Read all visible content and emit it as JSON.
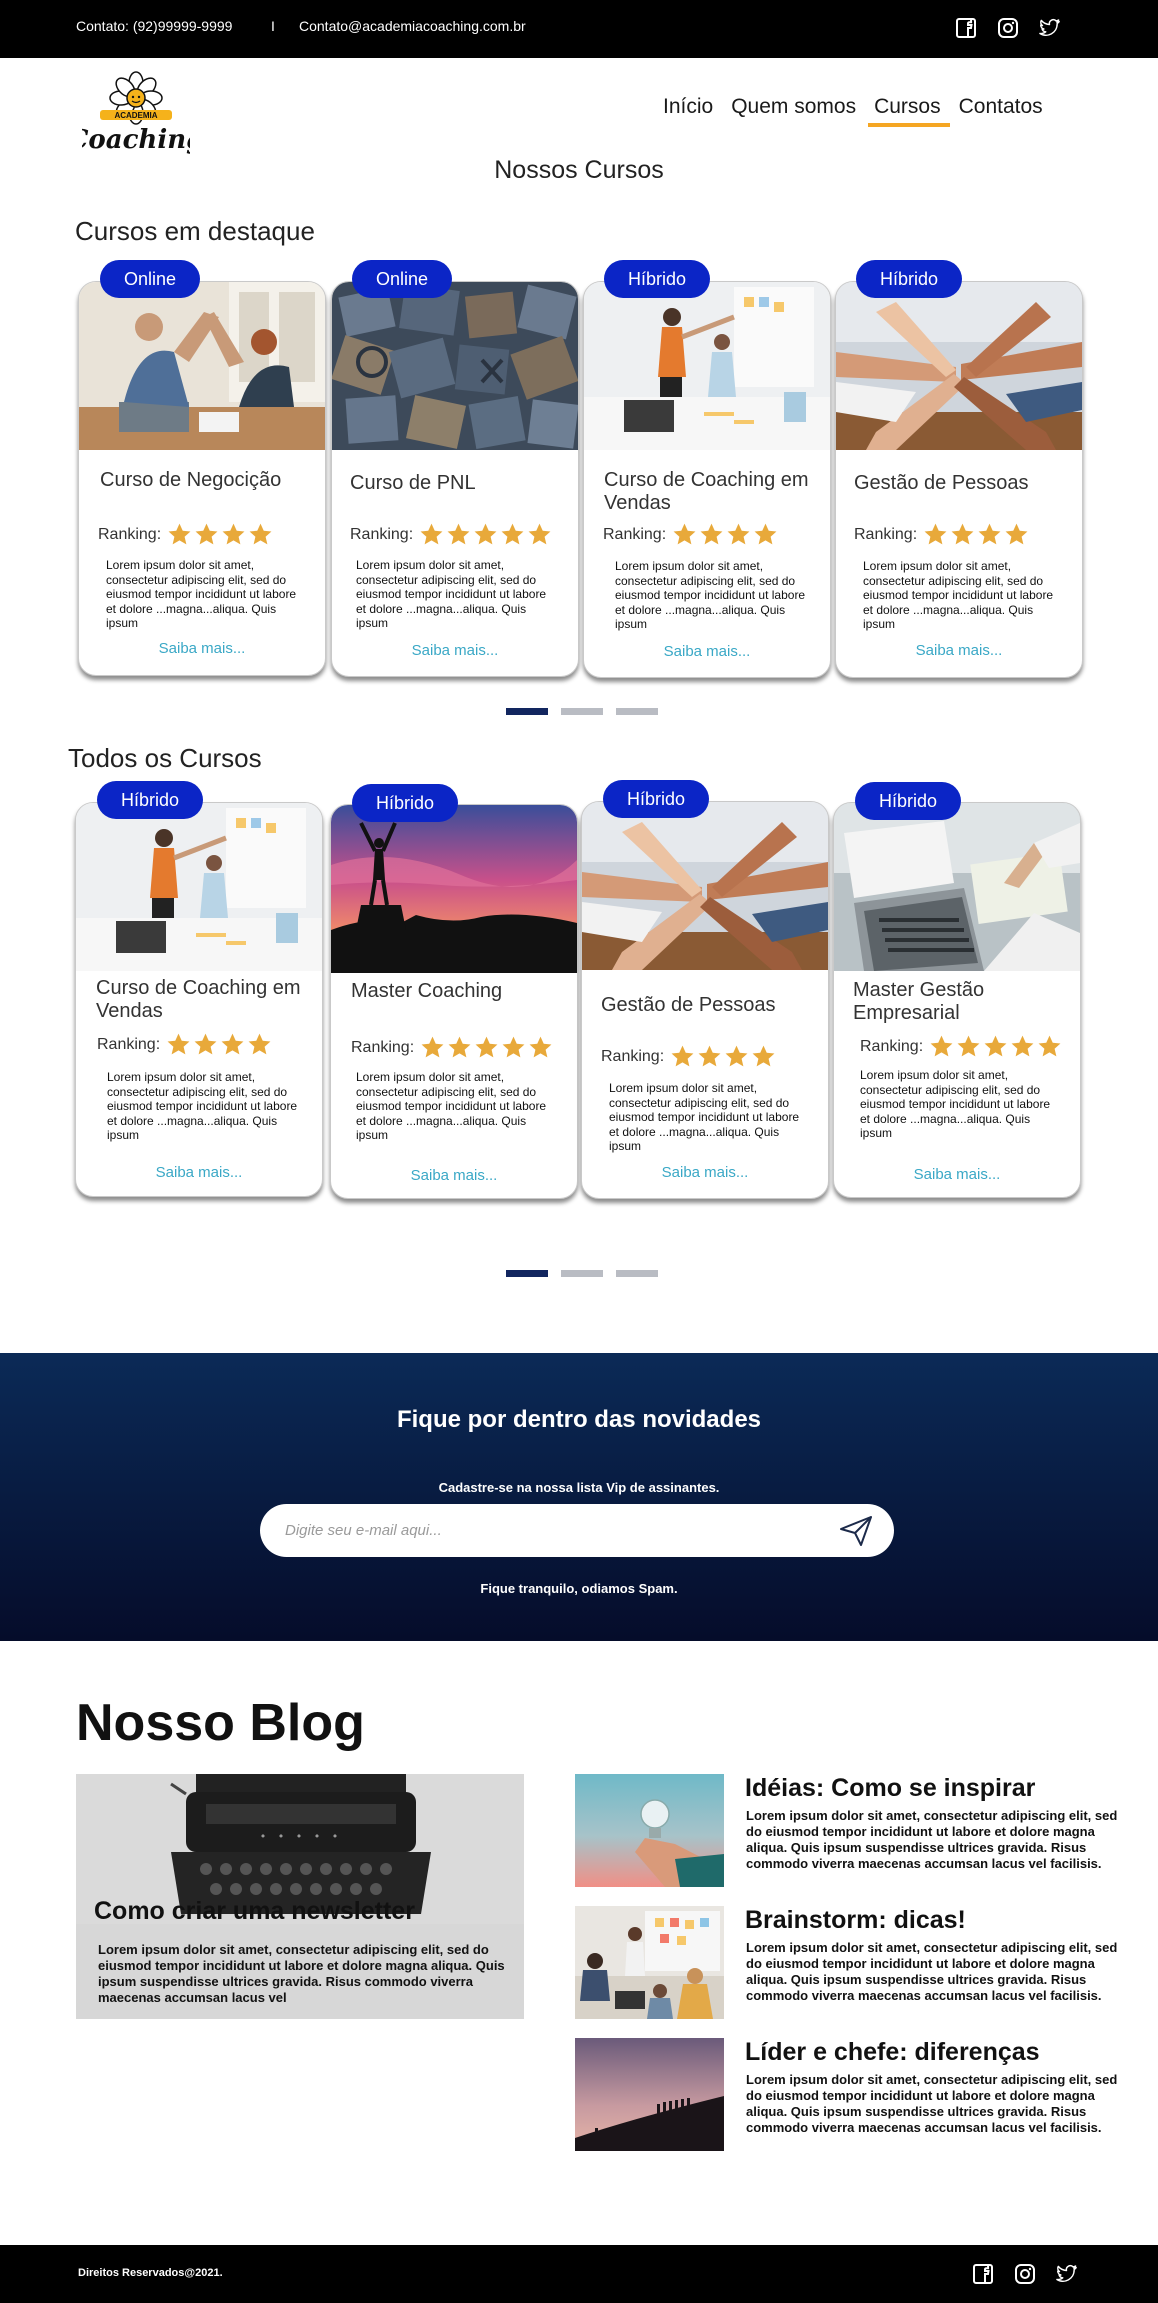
{
  "topbar": {
    "contact": "Contato: (92)99999-9999",
    "separator": "I",
    "email": "Contato@academiacoaching.com.br",
    "social": [
      "facebook-icon",
      "instagram-icon",
      "twitter-icon"
    ]
  },
  "logo": {
    "top_text": "ACADEMIA",
    "name": "Coaching"
  },
  "nav": [
    {
      "label": "Início",
      "active": false
    },
    {
      "label": "Quem somos",
      "active": false
    },
    {
      "label": "Cursos",
      "active": true
    },
    {
      "label": "Contatos",
      "active": false
    }
  ],
  "page_title": "Nossos Cursos",
  "featured": {
    "title": "Cursos em destaque",
    "cards": [
      {
        "badge": "Online",
        "title": "Curso de Negocição",
        "stars": 4,
        "image": "meeting-high-five"
      },
      {
        "badge": "Online",
        "title": "Curso de PNL",
        "stars": 5,
        "image": "wooden-letters"
      },
      {
        "badge": "Híbrido",
        "title": "Curso de Coaching em Vendas",
        "stars": 4,
        "image": "whiteboard-presentation"
      },
      {
        "badge": "Híbrido",
        "title": "Gestão de Pessoas",
        "stars": 4,
        "image": "hands-together"
      }
    ],
    "dots": {
      "count": 3,
      "active": 1
    }
  },
  "all": {
    "title": "Todos os Cursos",
    "cards": [
      {
        "badge": "Híbrido",
        "title": "Curso de Coaching em Vendas",
        "stars": 4,
        "image": "whiteboard-presentation"
      },
      {
        "badge": "Híbrido",
        "title": "Master Coaching",
        "stars": 5,
        "image": "sunset-victory"
      },
      {
        "badge": "Híbrido",
        "title": "Gestão de Pessoas",
        "stars": 4,
        "image": "hands-together"
      },
      {
        "badge": "Híbrido",
        "title": "Master Gestão Empresarial",
        "stars": 5,
        "image": "laptop-meeting"
      }
    ],
    "dots": {
      "count": 3,
      "active": 1
    }
  },
  "card_common": {
    "ranking_label": "Ranking:",
    "description": "Lorem ipsum dolor sit amet, consectetur adipiscing elit, sed do eiusmod tempor incididunt ut labore et dolore ...magna...aliqua. Quis ipsum",
    "more": "Saiba mais..."
  },
  "newsletter": {
    "title": "Fique por dentro das novidades",
    "subtitle": "Cadastre-se na nossa lista Vip de assinantes.",
    "placeholder": "Digite seu e-mail aqui...",
    "note": "Fique tranquilo, odiamos Spam."
  },
  "blog": {
    "title": "Nosso Blog",
    "main": {
      "title": "Como criar uma newsletter",
      "text": "Lorem ipsum dolor sit amet, consectetur adipiscing elit, sed do eiusmod tempor incididunt ut labore et dolore magna aliqua. Quis ipsum suspendisse ultrices gravida. Risus commodo viverra maecenas accumsan lacus vel"
    },
    "posts": [
      {
        "title": "Idéias: Como se inspirar",
        "text": "Lorem ipsum dolor sit amet, consectetur adipiscing elit, sed do eiusmod tempor incididunt ut labore et dolore magna aliqua. Quis ipsum suspendisse ultrices gravida. Risus commodo viverra maecenas accumsan lacus vel facilisis.",
        "image": "lightbulb-hand"
      },
      {
        "title": "Brainstorm: dicas!",
        "text": "Lorem ipsum dolor sit amet, consectetur adipiscing elit, sed do eiusmod tempor incididunt ut labore et dolore magna aliqua. Quis ipsum suspendisse ultrices gravida. Risus commodo viverra maecenas accumsan lacus vel facilisis.",
        "image": "team-brainstorm"
      },
      {
        "title": "Líder e chefe: diferenças",
        "text": "Lorem ipsum dolor sit amet, consectetur adipiscing elit, sed do eiusmod tempor incididunt ut labore et dolore magna aliqua. Quis ipsum suspendisse ultrices gravida. Risus commodo viverra maecenas accumsan lacus vel facilisis.",
        "image": "people-hill"
      }
    ]
  },
  "footer": {
    "copyright": "Direitos Reservados@2021."
  },
  "colors": {
    "badge": "#0b25c6",
    "star": "#e8a93a",
    "link": "#3aa8c6",
    "nav_active": "#f5a623",
    "dot_active": "#12265f"
  }
}
